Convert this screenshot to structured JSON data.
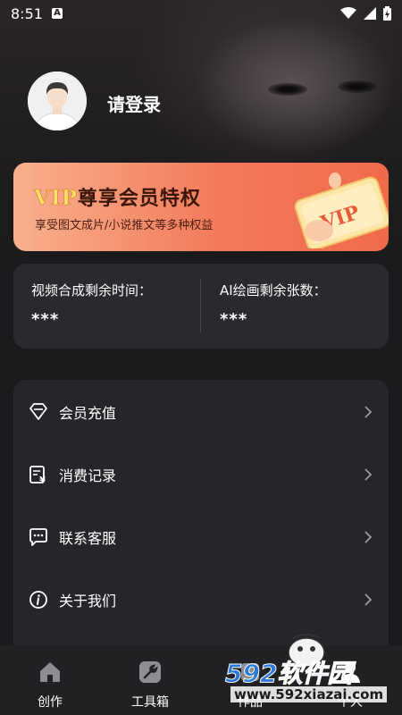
{
  "status_bar": {
    "time": "8:51",
    "a_badge": "A"
  },
  "profile": {
    "login_text": "请登录"
  },
  "vip_banner": {
    "vip_word": "VIP",
    "title_rest": "尊享会员特权",
    "subtitle": "享受图文成片/小说推文等多种权益",
    "card_text": "VIP"
  },
  "stats": {
    "video_label": "视频合成剩余时间：",
    "video_value": "***",
    "ai_label": "AI绘画剩余张数：",
    "ai_value": "***"
  },
  "menu": {
    "items": [
      {
        "label": "会员充值",
        "icon": "diamond-icon"
      },
      {
        "label": "消费记录",
        "icon": "receipt-yen-icon"
      },
      {
        "label": "联系客服",
        "icon": "chat-bubble-icon"
      },
      {
        "label": "关于我们",
        "icon": "info-icon"
      }
    ]
  },
  "tabbar": {
    "tabs": [
      {
        "label": "创作",
        "icon": "home-icon"
      },
      {
        "label": "工具箱",
        "icon": "wrench-icon"
      },
      {
        "label": "作品",
        "icon": "works-icon"
      },
      {
        "label": "个人",
        "icon": "person-icon"
      }
    ]
  },
  "watermark": {
    "brand": "592软件园",
    "url": "www.592xiazai.com"
  },
  "colors": {
    "vip_gradient_start": "#f8b08d",
    "vip_gradient_end": "#f06a4a",
    "card_bg": "#2a2a2e",
    "background": "#1a1a1c"
  }
}
